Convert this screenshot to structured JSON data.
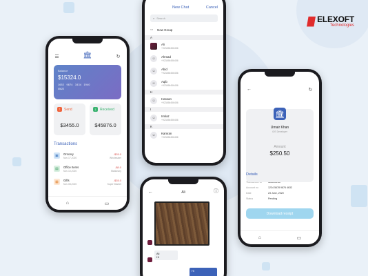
{
  "brand": {
    "name": "ELEXOFT",
    "tagline": "Technologies"
  },
  "wallet": {
    "card": {
      "label": "Balance",
      "balance": "$15324.0",
      "number": "1652 9874 3434 1940",
      "expiry": "05/22"
    },
    "send": {
      "label": "Send",
      "amount": "$3455.0"
    },
    "received": {
      "label": "Received",
      "amount": "$45876.0"
    },
    "transactions_title": "Transactions",
    "transactions": [
      {
        "name": "Grocery",
        "date": "Nov 17,2020",
        "amount": "-$35.0",
        "category": "Wholesaler",
        "icon_color": "#cfe3f7"
      },
      {
        "name": "Office Items",
        "date": "Nov 10,2020",
        "amount": "-$8.0",
        "category": "Stationary",
        "icon_color": "#d8efe0"
      },
      {
        "name": "Gifts",
        "date": "Nov 08,2020",
        "amount": "-$35.0",
        "category": "Super Market",
        "icon_color": "#fde7d3"
      }
    ]
  },
  "newchat": {
    "title": "New Chat",
    "cancel": "Cancel",
    "search_placeholder": "Search",
    "new_group": "New Group",
    "sections": [
      {
        "letter": "A",
        "contacts": [
          {
            "name": "Ali",
            "phone": "+923456456456",
            "photo": true
          },
          {
            "name": "Ahmad",
            "phone": "+923456456456"
          },
          {
            "name": "Abid",
            "phone": "+923456456456"
          },
          {
            "name": "Aqib",
            "phone": "+923456456456"
          }
        ]
      },
      {
        "letter": "H",
        "contacts": [
          {
            "name": "Hassan",
            "phone": "+923456456456"
          }
        ]
      },
      {
        "letter": "I",
        "contacts": [
          {
            "name": "Imtiaz",
            "phone": "+923456456456"
          }
        ]
      },
      {
        "letter": "K",
        "contacts": [
          {
            "name": "Kamran",
            "phone": "+923456456456"
          }
        ]
      }
    ]
  },
  "chat": {
    "title": "Ali",
    "bubble1": "Ali",
    "bubble2": "Hi",
    "reply": "Hi"
  },
  "receipt": {
    "name": "Umair Khan",
    "role": "iOS Developer",
    "amount_label": "Amount",
    "amount": "$250.50",
    "details_title": "Details",
    "rows": [
      {
        "key": "Transaction Id",
        "value": "fdff6hfvLfdf"
      },
      {
        "key": "Account no",
        "value": "1234  5678  9876  4632"
      },
      {
        "key": "Date",
        "value": "23 June, 2020"
      },
      {
        "key": "Status",
        "value": "Pending"
      }
    ],
    "download_label": "Download receipt"
  },
  "icons": {
    "bank": "bank-icon",
    "refresh": "refresh-icon",
    "menu": "menu-icon",
    "back": "back-icon",
    "home": "home-icon",
    "chat": "chat-icon"
  }
}
